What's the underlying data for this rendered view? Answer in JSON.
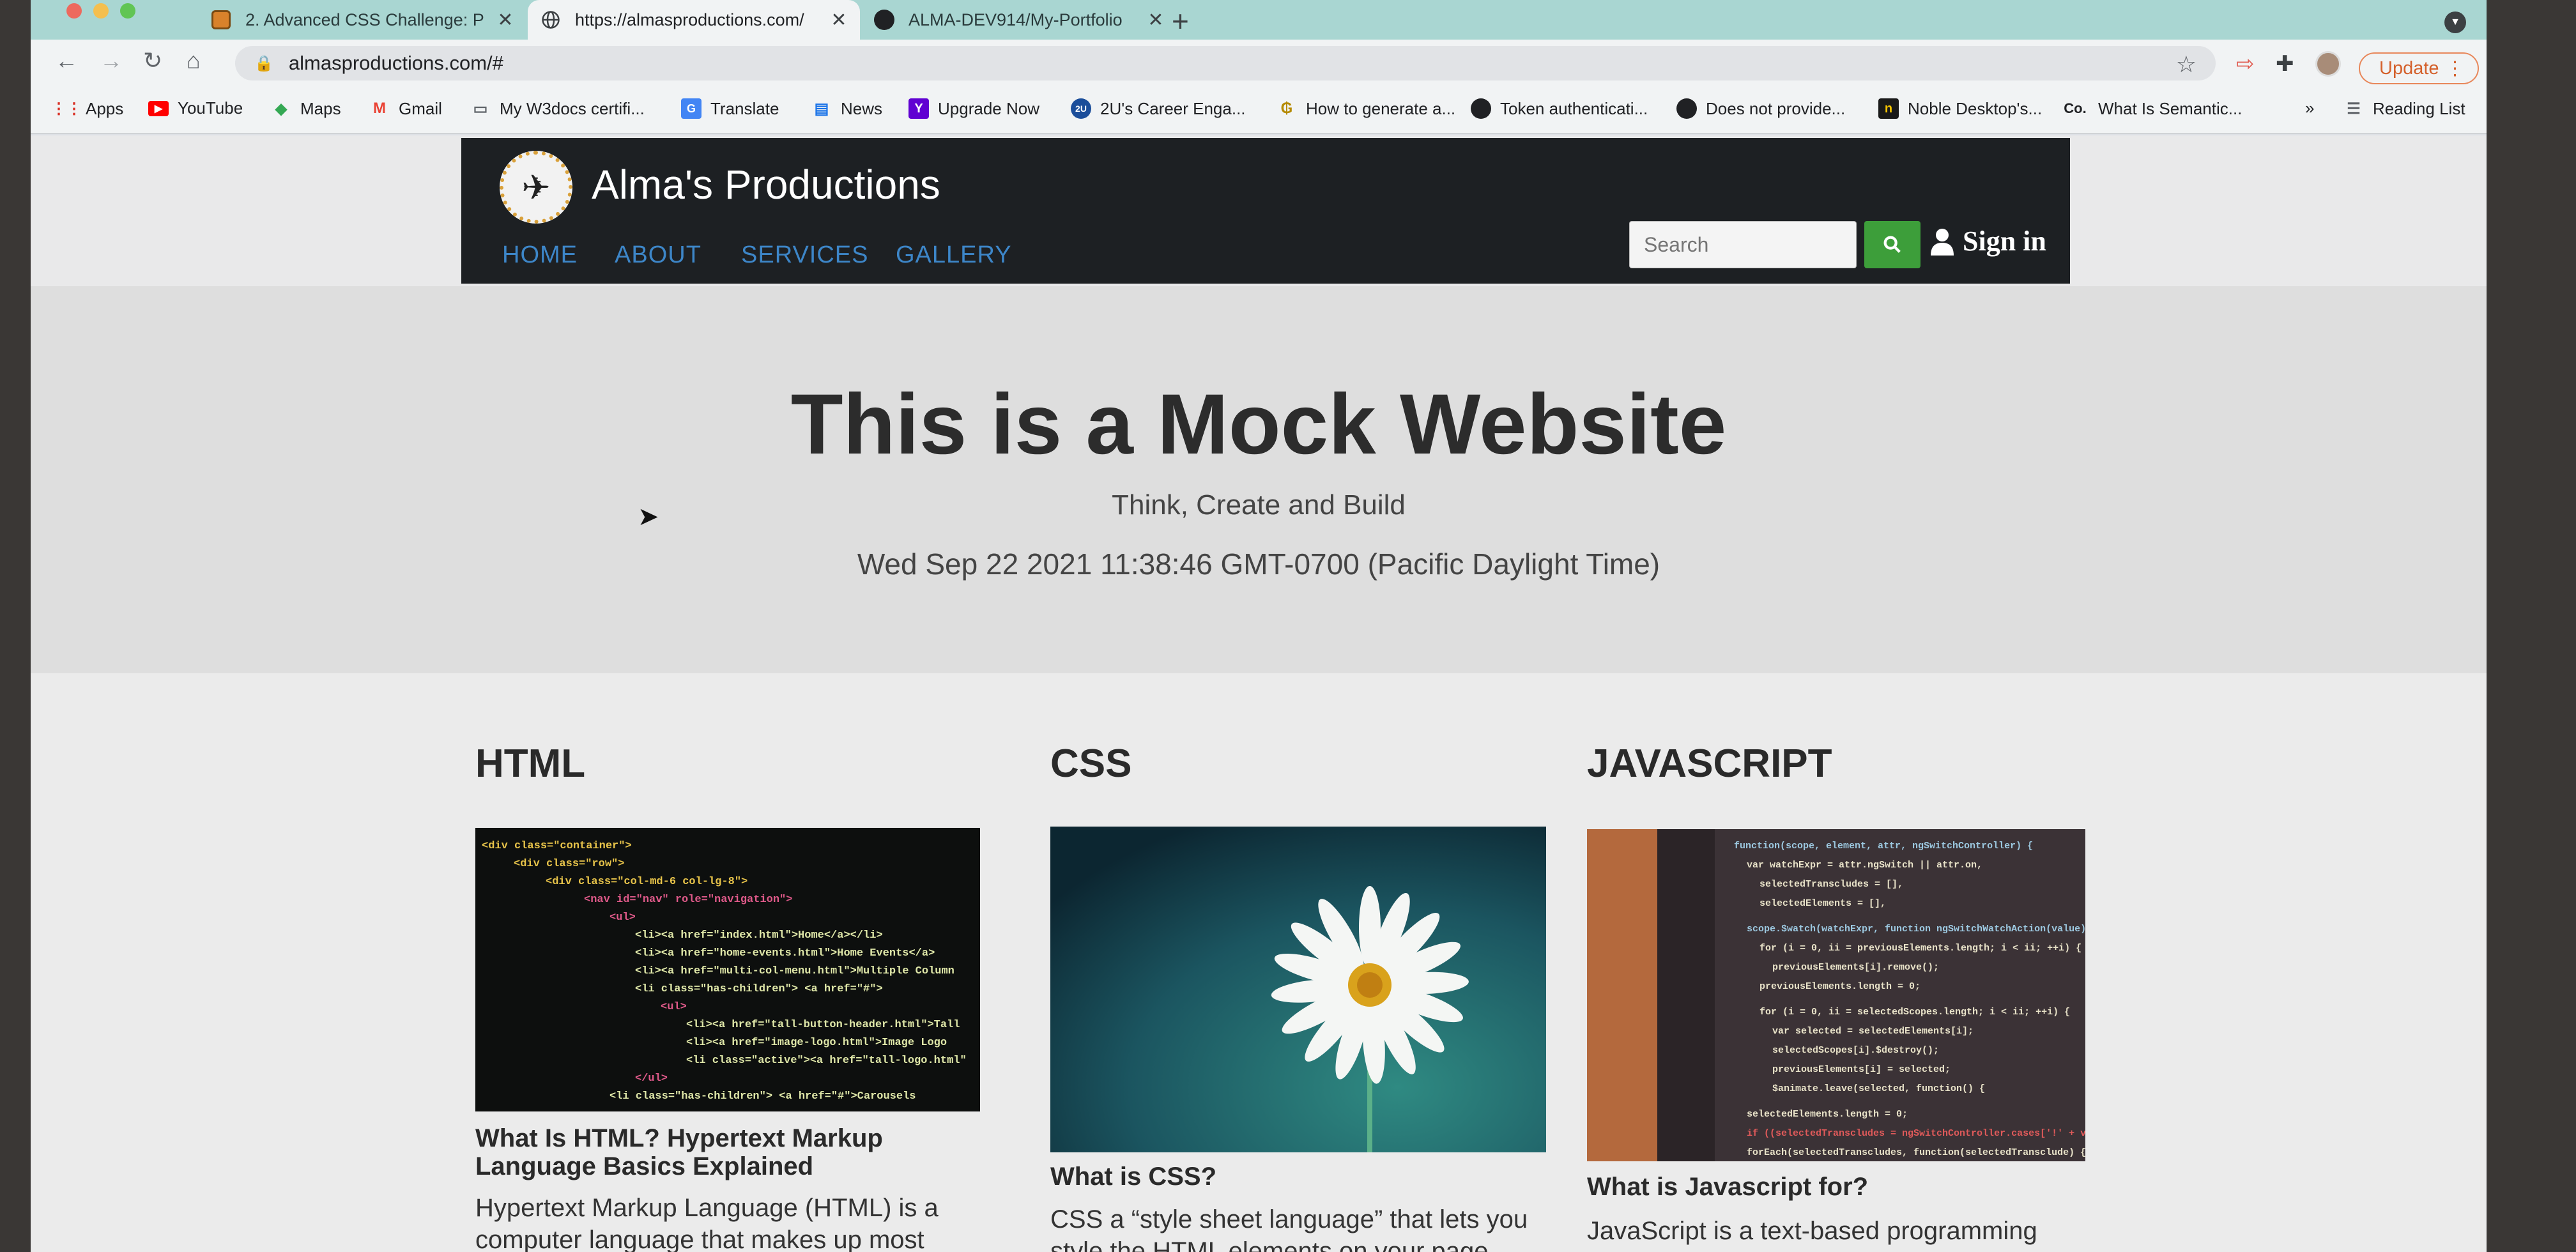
{
  "browser": {
    "tabs": [
      {
        "title": "2. Advanced CSS Challenge: P",
        "icon": "challenge-favicon"
      },
      {
        "title": "https://almasproductions.com/",
        "icon": "globe-favicon"
      },
      {
        "title": "ALMA-DEV914/My-Portfolio",
        "icon": "github-favicon"
      }
    ],
    "new_tab": "+",
    "url": "almasproductions.com/#",
    "update_label": "Update",
    "bookmarks": [
      {
        "label": "Apps",
        "icon": "apps-grid-icon"
      },
      {
        "label": "YouTube",
        "icon": "youtube-icon"
      },
      {
        "label": "Maps",
        "icon": "maps-icon"
      },
      {
        "label": "Gmail",
        "icon": "gmail-icon"
      },
      {
        "label": "My W3docs certifi...",
        "icon": "folder-icon"
      },
      {
        "label": "Translate",
        "icon": "translate-icon"
      },
      {
        "label": "News",
        "icon": "news-icon"
      },
      {
        "label": "Upgrade Now",
        "icon": "yahoo-icon"
      },
      {
        "label": "2U's Career Enga...",
        "icon": "2u-icon"
      },
      {
        "label": "How to generate a...",
        "icon": "site-icon"
      },
      {
        "label": "Token authenticati...",
        "icon": "github-icon"
      },
      {
        "label": "Does not provide...",
        "icon": "github-icon"
      },
      {
        "label": "Noble Desktop's...",
        "icon": "noble-icon"
      },
      {
        "label": "What Is Semantic...",
        "icon": "co-icon"
      }
    ],
    "bookmarks_overflow": "»",
    "reading_list": "Reading List"
  },
  "site": {
    "brand": "Alma's Productions",
    "nav": [
      "HOME",
      "ABOUT",
      "SERVICES",
      "GALLERY"
    ],
    "search_placeholder": "Search",
    "signin": "Sign in",
    "hero_title": "This is a Mock Website",
    "hero_subtitle": "Think, Create and Build",
    "hero_date": "Wed Sep 22 2021 11:38:46 GMT-0700 (Pacific Daylight Time)",
    "columns": [
      {
        "heading": "HTML",
        "image": "html-code-screenshot",
        "title": "What Is HTML? Hypertext Markup Language Basics Explained",
        "text": "Hypertext Markup Language (HTML) is a computer language that makes up most web"
      },
      {
        "heading": "CSS",
        "image": "daisy-flower-photo",
        "title": "What is CSS?",
        "text": "CSS a “style sheet language” that lets you style the HTML elements on your page. CSS works"
      },
      {
        "heading": "JAVASCRIPT",
        "image": "javascript-code-photo",
        "title": "What is Javascript for?",
        "text": "JavaScript is a text-based programming"
      }
    ]
  },
  "colors": {
    "tabbar": "#a9d6d2",
    "header_bg": "#1d2023",
    "nav_link": "#3d86c8",
    "search_button": "#3d9e3a",
    "update_border": "#e8875a"
  }
}
